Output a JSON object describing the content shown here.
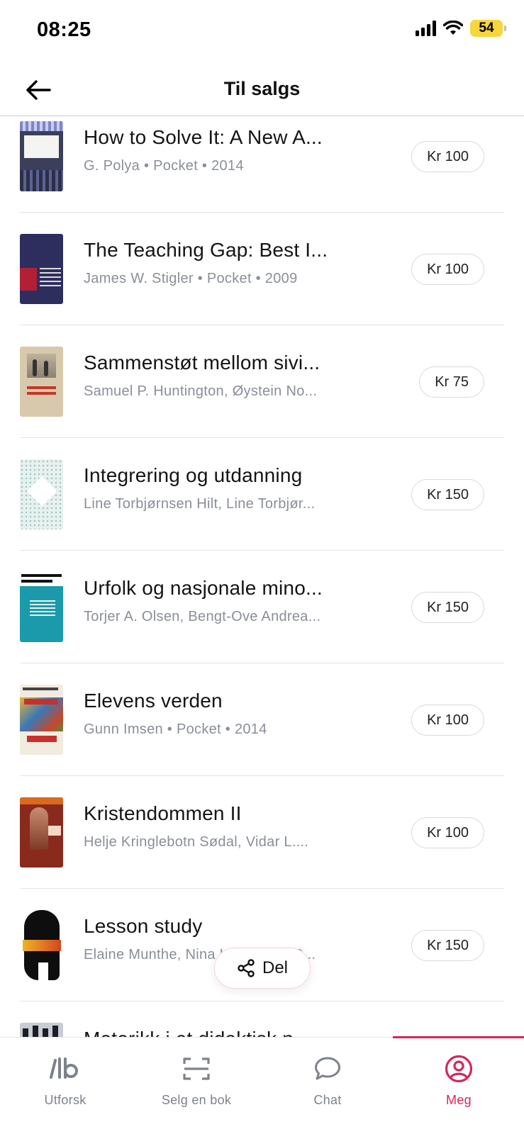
{
  "status_bar": {
    "time": "08:25",
    "battery": "54"
  },
  "header": {
    "title": "Til salgs"
  },
  "books": [
    {
      "title": "How to Solve It: A New A...",
      "meta": "G. Polya • Pocket • 2014",
      "price": "Kr 100",
      "cover": {
        "bg": "#3b3f5c",
        "text": "HOW TO SOLVE IT",
        "style": "solve"
      }
    },
    {
      "title": "The Teaching Gap: Best I...",
      "meta": "James W. Stigler • Pocket • 2009",
      "price": "Kr 100",
      "cover": {
        "bg": "#2d2d5e",
        "text": "The Teaching Gap",
        "style": "gap"
      }
    },
    {
      "title": "Sammenstøt mellom sivi...",
      "meta": "Samuel P. Huntington, Øystein No...",
      "price": "Kr 75",
      "cover": {
        "bg": "#d9c9ac",
        "text": "SAMMENSTØT MELLOM SIVILISASJONER",
        "style": "samm"
      }
    },
    {
      "title": "Integrering og utdanning",
      "meta": "Line Torbjørnsen Hilt, Line Torbjør...",
      "price": "Kr 150",
      "cover": {
        "bg": "#e8f1ef",
        "text": "INTEGRERING OG UTDANNING",
        "style": "integ"
      }
    },
    {
      "title": "Urfolk og nasjonale mino...",
      "meta": "Torjer A. Olsen, Bengt-Ove Andrea...",
      "price": "Kr 150",
      "cover": {
        "bg": "#1a9aaa",
        "text": "URFOLK OG NASJONALE MINORITETER",
        "style": "urfolk"
      }
    },
    {
      "title": "Elevens verden",
      "meta": "Gunn Imsen • Pocket • 2014",
      "price": "Kr 100",
      "cover": {
        "bg": "#f2ece0",
        "text": "GUNN IMSEN Elevens verden",
        "style": "elevens"
      }
    },
    {
      "title": "Kristendommen II",
      "meta": "Helje Kringlebotn Sødal, Vidar L....",
      "price": "Kr 100",
      "cover": {
        "bg": "#8a2a1c",
        "text": "TRO OG TRADISJON",
        "style": "krist"
      }
    },
    {
      "title": "Lesson study",
      "meta": "Elaine Munthe, Nina Helgevold, R...",
      "price": "Kr 150",
      "cover": {
        "bg": "#ffffff",
        "text": "LESSON STUDY",
        "style": "lesson"
      }
    },
    {
      "title": "Motorikk i et didaktisk p...",
      "meta": "",
      "price": "Kr 100",
      "cover": {
        "bg": "#c8ccd4",
        "text": "",
        "style": "motor"
      }
    }
  ],
  "share": {
    "label": "Del"
  },
  "tabs": [
    {
      "label": "Utforsk",
      "icon": "logo-icon"
    },
    {
      "label": "Selg en bok",
      "icon": "scan-icon"
    },
    {
      "label": "Chat",
      "icon": "chat-bubble-icon"
    },
    {
      "label": "Meg",
      "icon": "user-circle-icon"
    }
  ],
  "colors": {
    "accent": "#d2285a",
    "muted": "#8a8f98",
    "divider": "#dfe3e8"
  }
}
